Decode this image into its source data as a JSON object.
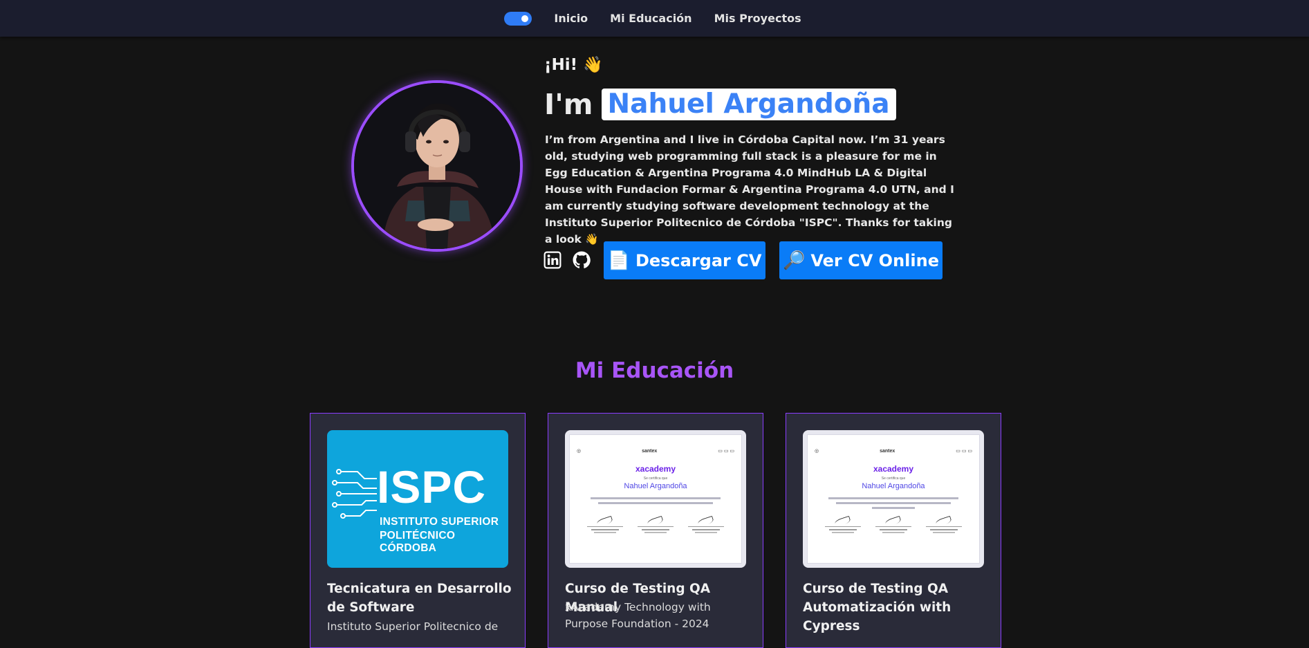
{
  "nav": {
    "theme_toggle": "theme-toggle",
    "links": [
      "Inicio",
      "Mi Educación",
      "Mis Proyectos"
    ]
  },
  "hero": {
    "greeting": "¡Hi! 👋",
    "intro": "I'm",
    "name": "Nahuel Argandoña",
    "bio": "I’m from Argentina and I live in Córdoba Capital now. I’m 31 years old, studying web programming full stack is a pleasure for me in Egg Education & Argentina Programa 4.0 MindHub LA & Digital House with Fundacion Formar & Argentina Programa 4.0 UTN, and I am currently studying software development technology at the Instituto Superior Politecnico de Córdoba \"ISPC\". Thanks for taking a look 👋",
    "social": [
      "linkedin-icon",
      "github-icon"
    ],
    "buttons": {
      "download_icon": "📄",
      "download_label": "Descargar CV",
      "online_icon": "🔎",
      "online_label": "Ver CV Online"
    }
  },
  "education": {
    "title": "Mi Educación",
    "cards": [
      {
        "title": "Tecnicatura en Desarrollo de Software",
        "subtitle": "Instituto Superior Politecnico de",
        "logo": {
          "acronym": "ISPC",
          "line1": "INSTITUTO SUPERIOR",
          "line2": "POLITÉCNICO CÓRDOBA"
        }
      },
      {
        "title": "Curso de Testing QA Manual",
        "subtitle": "xAcademy Technology with Purpose Foundation - 2024",
        "cert": {
          "brand": "xacademy",
          "top": "santex",
          "certifies": "Se certifica que",
          "name": "Nahuel Argandoña"
        }
      },
      {
        "title": "Curso de Testing QA Automatización with Cypress",
        "subtitle": "",
        "cert": {
          "brand": "xacademy",
          "top": "santex",
          "certifies": "Se certifica que",
          "name": "Nahuel Argandoña"
        }
      }
    ]
  },
  "colors": {
    "accent_purple": "#a855f7",
    "button_blue": "#0a7cf7",
    "name_blue": "#3b82f6",
    "nav_bg": "#1b1d2e"
  }
}
